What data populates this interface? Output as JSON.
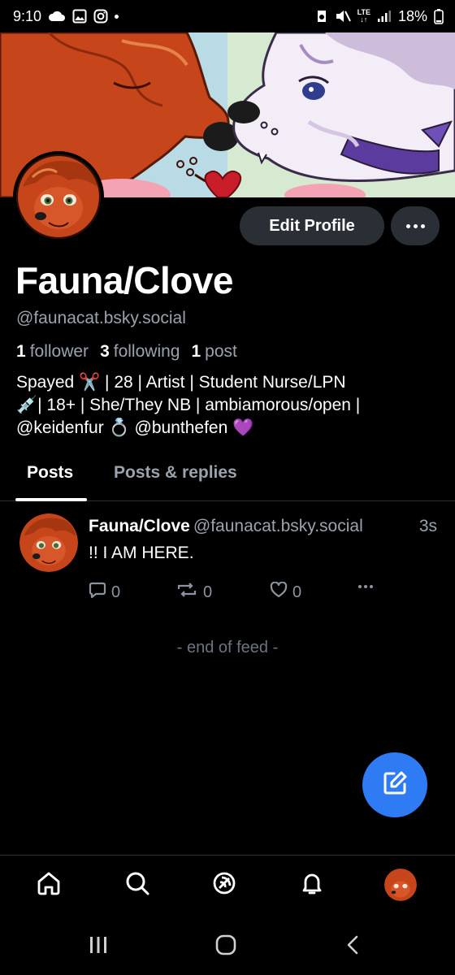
{
  "status_bar": {
    "time": "9:10",
    "battery": "18%",
    "network_top": "LTE",
    "network_bottom": "↓↑"
  },
  "profile": {
    "display_name": "Fauna/Clove",
    "handle": "@faunacat.bsky.social",
    "edit_label": "Edit Profile",
    "stats": {
      "followers_count": "1",
      "followers_label": "follower",
      "following_count": "3",
      "following_label": "following",
      "posts_count": "1",
      "posts_label": "post"
    },
    "bio_lines": [
      "Spayed ✂️ | 28 | Artist | Student Nurse/LPN",
      "💉| 18+ | She/They NB | ambiamorous/open |",
      "@keidenfur 💍 @bunthefen 💜"
    ]
  },
  "tabs": [
    {
      "label": "Posts",
      "active": true
    },
    {
      "label": "Posts & replies",
      "active": false
    }
  ],
  "post": {
    "author_name": "Fauna/Clove",
    "author_handle": "@faunacat.bsky.social",
    "time": "3s",
    "text": "!! I AM HERE.",
    "reply_count": "0",
    "repost_count": "0",
    "like_count": "0"
  },
  "feed_end_text": "- end of feed -",
  "colors": {
    "background": "#000000",
    "accent": "#2f7bf4",
    "muted_text": "#9aa3ad",
    "button_bg": "#2a2e35"
  },
  "icons": {
    "bottom_nav": [
      "home-icon",
      "search-icon",
      "feeds-icon",
      "notifications-icon",
      "profile-avatar"
    ],
    "system_nav": [
      "recent-apps-icon",
      "home-circle-icon",
      "back-icon"
    ],
    "fab": "compose-icon"
  }
}
